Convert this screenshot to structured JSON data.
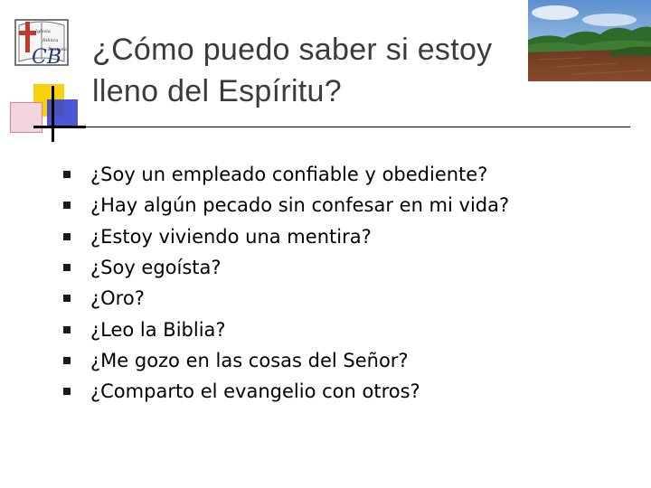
{
  "title": {
    "line1": "¿Cómo puedo saber si estoy",
    "line2": "lleno del Espíritu?"
  },
  "bullets": [
    "¿Soy un empleado confiable y obediente?",
    "¿Hay algún pecado sin confesar en mi vida?",
    "¿Estoy viviendo una mentira?",
    "¿Soy egoísta?",
    "¿Oro?",
    "¿Leo la Biblia?",
    "¿Me gozo en las cosas del Señor?",
    "¿Comparto el evangelio con otros?"
  ],
  "logo": {
    "icon": "church-book-cross-logo",
    "letters": "CB",
    "words": [
      "Iglesia",
      "Bíblica",
      "Bautista"
    ]
  },
  "photo": {
    "icon": "river-landscape-photo"
  },
  "colors": {
    "accent_yellow": "#f7d20a",
    "accent_blue": "#3a45d2",
    "accent_pink": "#e87c98",
    "title": "#3b3b3b",
    "logo_red": "#c0392b"
  }
}
